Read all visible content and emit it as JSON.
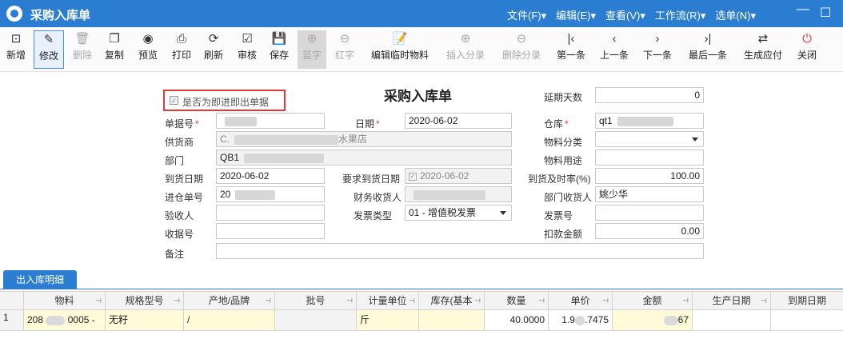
{
  "window": {
    "title": "采购入库单",
    "menus": [
      "文件(F)▾",
      "编辑(E)▾",
      "查看(V)▾",
      "工作流(R)▾",
      "选单(N)▾"
    ],
    "min_glyph": "—",
    "max_glyph": "☐"
  },
  "toolbar": {
    "new": "新增",
    "edit": "修改",
    "delete": "删除",
    "copy": "复制",
    "preview": "预览",
    "print": "打印",
    "refresh": "刷新",
    "audit": "审核",
    "save": "保存",
    "blue": "蓝字",
    "red": "红字",
    "edit_temp": "编辑临时物料",
    "insert_row": "插入分录",
    "delete_row": "删除分录",
    "first": "第一条",
    "prev": "上一条",
    "next": "下一条",
    "last": "最后一条",
    "gen_payable": "生成应付",
    "close": "关闭"
  },
  "form": {
    "heading": "采购入库单",
    "checkbox_label": "是否为即进即出单据",
    "labels": {
      "bill_no": "单据号",
      "date": "日期",
      "warehouse": "仓库",
      "delay_days": "延期天数",
      "supplier": "供货商",
      "material_cat": "物料分类",
      "dept": "部门",
      "material_use": "物料用途",
      "arrive_date": "到货日期",
      "req_arrive_date": "要求到货日期",
      "ontime_rate": "到货及时率(%)",
      "entry_no": "进仓单号",
      "fin_receiver": "财务收货人",
      "dept_receiver": "部门收货人",
      "inspector": "验收人",
      "invoice_type": "发票类型",
      "invoice_no": "发票号",
      "receipt_no": "收据号",
      "deduct": "扣款金额",
      "remark": "备注"
    },
    "values": {
      "delay_days": "0",
      "date": "2020-06-02",
      "warehouse": "qt1",
      "supplier_prefix": "C.",
      "supplier_suffix": "水果店",
      "dept": "QB1",
      "arrive_date": "2020-06-02",
      "req_arrive_date": "2020-06-02",
      "ontime_rate": "100.00",
      "entry_no": "20",
      "dept_receiver": "姚少华",
      "invoice_type": "01 - 增值税发票",
      "deduct": "0.00"
    }
  },
  "tab": {
    "label": "出入库明细"
  },
  "grid": {
    "columns": [
      "物料",
      "规格型号",
      "产地/品牌",
      "批号",
      "计量单位",
      "库存(基本",
      "数量",
      "单价",
      "金额",
      "生产日期",
      "到期日期"
    ],
    "row_index": "1",
    "row": {
      "material_a": "208",
      "material_b": "0005 -",
      "spec": "无籽",
      "origin": "/",
      "unit": "斤",
      "qty": "40.0000",
      "price_a": "1.9",
      "price_b": ".7475",
      "amount_b": "67"
    }
  }
}
